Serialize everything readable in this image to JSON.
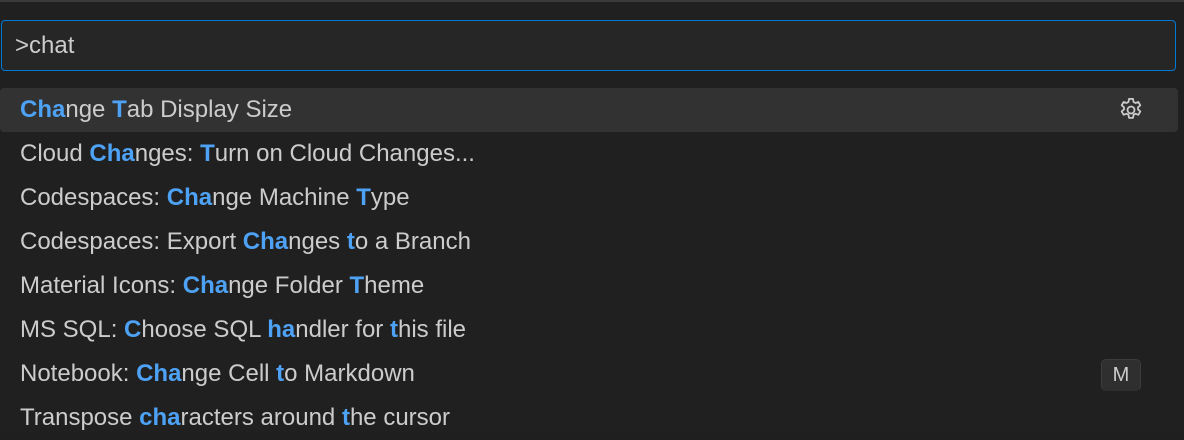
{
  "search": {
    "value": ">chat"
  },
  "results": [
    {
      "segments": [
        {
          "t": "Cha",
          "h": true
        },
        {
          "t": "nge ",
          "h": false
        },
        {
          "t": "T",
          "h": true
        },
        {
          "t": "ab Display Size",
          "h": false
        }
      ],
      "selected": true,
      "action_icon": "gear-icon"
    },
    {
      "segments": [
        {
          "t": "Cloud ",
          "h": false
        },
        {
          "t": "Cha",
          "h": true
        },
        {
          "t": "nges: ",
          "h": false
        },
        {
          "t": "T",
          "h": true
        },
        {
          "t": "urn on Cloud Changes...",
          "h": false
        }
      ]
    },
    {
      "segments": [
        {
          "t": "Codespaces: ",
          "h": false
        },
        {
          "t": "Cha",
          "h": true
        },
        {
          "t": "nge Machine ",
          "h": false
        },
        {
          "t": "T",
          "h": true
        },
        {
          "t": "ype",
          "h": false
        }
      ]
    },
    {
      "segments": [
        {
          "t": "Codespaces: Export ",
          "h": false
        },
        {
          "t": "Cha",
          "h": true
        },
        {
          "t": "nges ",
          "h": false
        },
        {
          "t": "t",
          "h": true
        },
        {
          "t": "o a Branch",
          "h": false
        }
      ]
    },
    {
      "segments": [
        {
          "t": "Material Icons: ",
          "h": false
        },
        {
          "t": "Cha",
          "h": true
        },
        {
          "t": "nge Folder ",
          "h": false
        },
        {
          "t": "T",
          "h": true
        },
        {
          "t": "heme",
          "h": false
        }
      ]
    },
    {
      "segments": [
        {
          "t": "MS SQL: ",
          "h": false
        },
        {
          "t": "C",
          "h": true
        },
        {
          "t": "hoose SQL ",
          "h": false
        },
        {
          "t": "ha",
          "h": true
        },
        {
          "t": "ndler for ",
          "h": false
        },
        {
          "t": "t",
          "h": true
        },
        {
          "t": "his file",
          "h": false
        }
      ]
    },
    {
      "segments": [
        {
          "t": "Notebook: ",
          "h": false
        },
        {
          "t": "Cha",
          "h": true
        },
        {
          "t": "nge Cell ",
          "h": false
        },
        {
          "t": "t",
          "h": true
        },
        {
          "t": "o Markdown",
          "h": false
        }
      ],
      "keybinding": "M"
    },
    {
      "segments": [
        {
          "t": "Transpose ",
          "h": false
        },
        {
          "t": "cha",
          "h": true
        },
        {
          "t": "racters around ",
          "h": false
        },
        {
          "t": "t",
          "h": true
        },
        {
          "t": "he cursor",
          "h": false
        }
      ]
    }
  ],
  "colors": {
    "highlight": "#4ea2f5",
    "focus_border": "#0078d4",
    "selected_row": "#323233"
  }
}
